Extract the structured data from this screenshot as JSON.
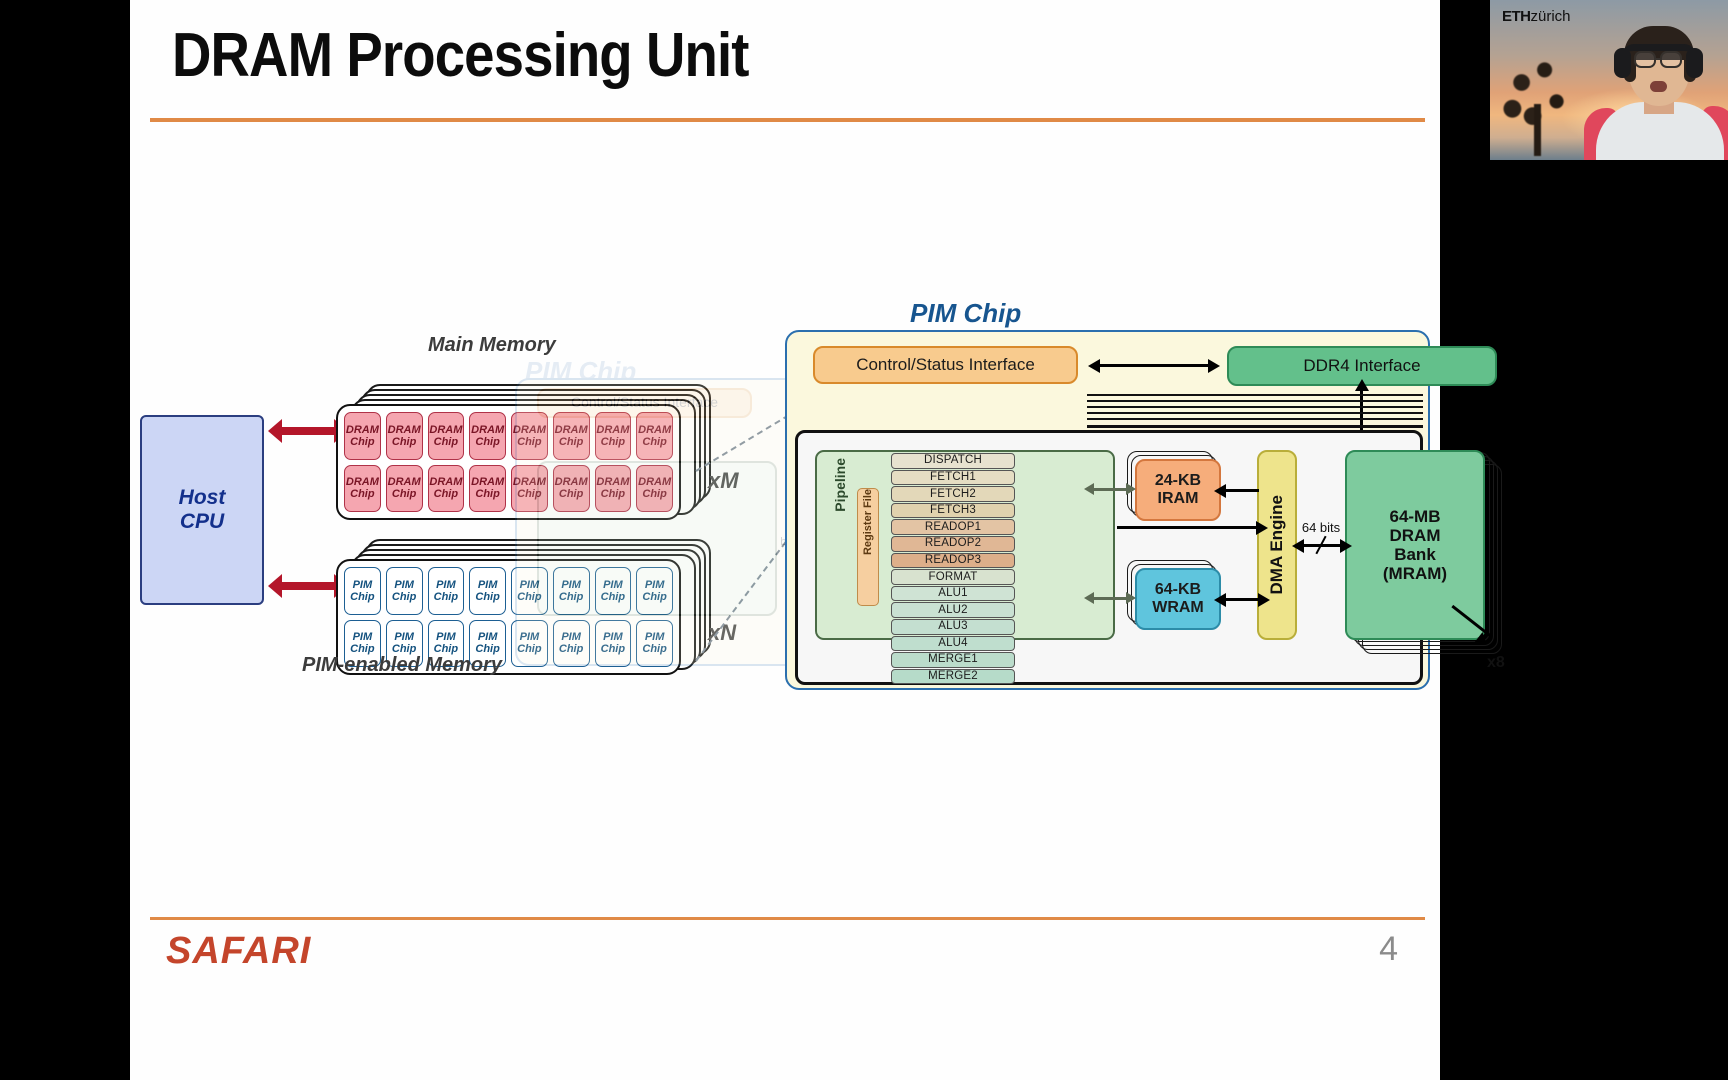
{
  "slide": {
    "title": "DRAM Processing Unit",
    "footer_logo": "SAFARI",
    "page_number": "4"
  },
  "webcam": {
    "logo_bold": "ETH",
    "logo_light": "zürich"
  },
  "system_diagram": {
    "host_cpu_line1": "Host",
    "host_cpu_line2": "CPU",
    "main_memory_label": "Main Memory",
    "pim_memory_label": "PIM-enabled Memory",
    "dram_chip_line1": "DRAM",
    "dram_chip_line2": "Chip",
    "pim_chip_line1": "PIM",
    "pim_chip_line2": "Chip",
    "multiplier_m": "xM",
    "multiplier_n": "xN",
    "dram_chip_count": 16,
    "pim_chip_count": 16
  },
  "pim_chip": {
    "heading": "PIM Chip",
    "ghost_heading": "PIM Chip",
    "control_status": "Control/Status Interface",
    "ddr4": "DDR4 Interface",
    "iram": "24-KB\nIRAM",
    "iram_line1": "24-KB",
    "iram_line2": "IRAM",
    "wram_line1": "64-KB",
    "wram_line2": "WRAM",
    "dma_engine": "DMA Engine",
    "mram_line1": "64-MB",
    "mram_line2": "DRAM",
    "mram_line3": "Bank",
    "mram_line4": "(MRAM)",
    "bus_width": "64 bits",
    "bank_multiplier": "x8",
    "core_multiplier": "x8",
    "pipeline_label": "Pipeline",
    "register_file_label": "Register File",
    "pipeline_stages": [
      "DISPATCH",
      "FETCH1",
      "FETCH2",
      "FETCH3",
      "READOP1",
      "READOP2",
      "READOP3",
      "FORMAT",
      "ALU1",
      "ALU2",
      "ALU3",
      "ALU4",
      "MERGE1",
      "MERGE2"
    ]
  },
  "colors": {
    "accent_rule": "#e08a46",
    "safari_red": "#c4452b",
    "title_blue": "#17558f",
    "dram_chip": "#f5a6b0",
    "control_status": "#f8cb8e",
    "ddr4_green": "#63c08b",
    "iram_orange": "#f6ad7b",
    "wram_cyan": "#5fc5dd",
    "dma_yellow": "#eee48c",
    "mram_green": "#7ecb9e",
    "core_green": "#d8ecd2",
    "host_blue": "#ccd6f5",
    "arrow_red": "#b4162a"
  }
}
